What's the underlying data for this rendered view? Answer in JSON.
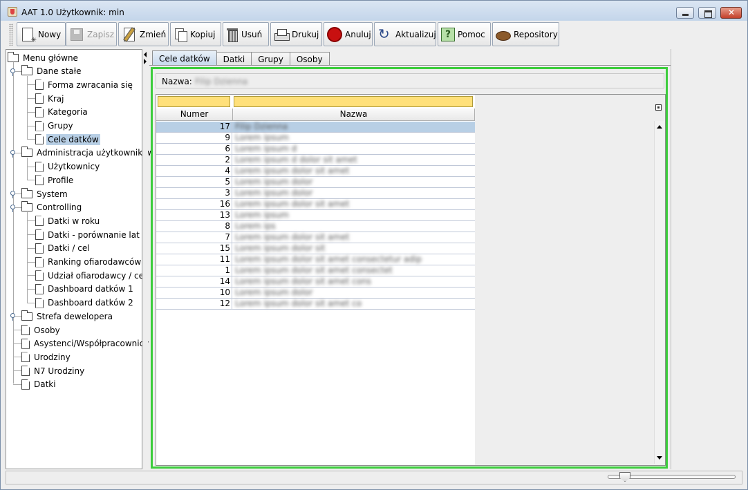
{
  "window": {
    "title": "AAT 1.0  Użytkownik: min"
  },
  "toolbar": {
    "buttons": [
      {
        "label": "Nowy",
        "icon": "new-document-icon",
        "enabled": true
      },
      {
        "label": "Zapisz",
        "icon": "save-disk-icon",
        "enabled": false
      },
      {
        "label": "Zmień",
        "icon": "edit-pencil-icon",
        "enabled": true
      },
      {
        "label": "Kopiuj",
        "icon": "copy-icon",
        "enabled": true
      },
      {
        "label": "Usuń",
        "icon": "trash-icon",
        "enabled": true
      },
      {
        "label": "Drukuj",
        "icon": "printer-icon",
        "enabled": true
      },
      {
        "label": "Anuluj",
        "icon": "stop-icon",
        "enabled": true
      },
      {
        "label": "Aktualizuj",
        "icon": "refresh-icon",
        "enabled": true
      },
      {
        "label": "Pomoc",
        "icon": "help-icon",
        "enabled": true
      },
      {
        "label": "Repository",
        "icon": "repository-icon",
        "enabled": true
      }
    ]
  },
  "tree": {
    "root": "Menu główne",
    "items": [
      {
        "label": "Dane stałe",
        "type": "folder",
        "level": 1,
        "expanded": true
      },
      {
        "label": "Forma zwracania się",
        "type": "leaf",
        "level": 2
      },
      {
        "label": "Kraj",
        "type": "leaf",
        "level": 2
      },
      {
        "label": "Kategoria",
        "type": "leaf",
        "level": 2
      },
      {
        "label": "Grupy",
        "type": "leaf",
        "level": 2
      },
      {
        "label": "Cele datków",
        "type": "leaf",
        "level": 2,
        "selected": true
      },
      {
        "label": "Administracja użytkowników",
        "type": "folder",
        "level": 1,
        "expanded": true
      },
      {
        "label": "Użytkownicy",
        "type": "leaf",
        "level": 2
      },
      {
        "label": "Profile",
        "type": "leaf",
        "level": 2
      },
      {
        "label": "System",
        "type": "folder",
        "level": 1,
        "expanded": false
      },
      {
        "label": "Controlling",
        "type": "folder",
        "level": 1,
        "expanded": true
      },
      {
        "label": "Datki w roku",
        "type": "leaf",
        "level": 2
      },
      {
        "label": "Datki - porównanie lat",
        "type": "leaf",
        "level": 2
      },
      {
        "label": "Datki / cel",
        "type": "leaf",
        "level": 2
      },
      {
        "label": "Ranking ofiarodawców",
        "type": "leaf",
        "level": 2
      },
      {
        "label": "Udział ofiarodawcy / cel",
        "type": "leaf",
        "level": 2
      },
      {
        "label": "Dashboard datków 1",
        "type": "leaf",
        "level": 2
      },
      {
        "label": "Dashboard datków 2",
        "type": "leaf",
        "level": 2
      },
      {
        "label": "Strefa dewelopera",
        "type": "folder",
        "level": 1,
        "expanded": false
      },
      {
        "label": "Osoby",
        "type": "leaf",
        "level": 1
      },
      {
        "label": "Asystenci/Współpracownicy",
        "type": "leaf",
        "level": 1
      },
      {
        "label": "Urodziny",
        "type": "leaf",
        "level": 1
      },
      {
        "label": "N7 Urodziny",
        "type": "leaf",
        "level": 1
      },
      {
        "label": "Datki",
        "type": "leaf",
        "level": 1
      }
    ]
  },
  "tabs": [
    {
      "label": "Cele datków",
      "active": true
    },
    {
      "label": "Datki",
      "active": false
    },
    {
      "label": "Grupy",
      "active": false
    },
    {
      "label": "Osoby",
      "active": false
    }
  ],
  "form": {
    "name_label": "Nazwa:",
    "name_value": "Filip Dzienna"
  },
  "table": {
    "columns": [
      "Numer",
      "Nazwa"
    ],
    "rows": [
      {
        "num": "17",
        "name": "Filip Dzienna",
        "selected": true
      },
      {
        "num": "9",
        "name": "Lorem ipsum",
        "selected": false
      },
      {
        "num": "6",
        "name": "Lorem ipsum d",
        "selected": false
      },
      {
        "num": "2",
        "name": "Lorem ipsum d dolor sit amet",
        "selected": false
      },
      {
        "num": "4",
        "name": "Lorem ipsum dolor sit amet",
        "selected": false
      },
      {
        "num": "5",
        "name": "Lorem ipsum dolor",
        "selected": false
      },
      {
        "num": "3",
        "name": "Lorem ipsum dolor",
        "selected": false
      },
      {
        "num": "16",
        "name": "Lorem ipsum dolor sit amet",
        "selected": false
      },
      {
        "num": "13",
        "name": "Lorem ipsum",
        "selected": false
      },
      {
        "num": "8",
        "name": "Lorem ips",
        "selected": false
      },
      {
        "num": "7",
        "name": "Lorem ipsum dolor sit amet",
        "selected": false
      },
      {
        "num": "15",
        "name": "Lorem ipsum dolor sit",
        "selected": false
      },
      {
        "num": "11",
        "name": "Lorem ipsum dolor sit amet consectetur adip",
        "selected": false
      },
      {
        "num": "1",
        "name": "Lorem ipsum dolor sit amet consectet",
        "selected": false
      },
      {
        "num": "14",
        "name": "Lorem ipsum dolor sit amet cons",
        "selected": false
      },
      {
        "num": "10",
        "name": "Lorem ipsum dolor",
        "selected": false
      },
      {
        "num": "12",
        "name": "Lorem ipsum dolor sit amet co",
        "selected": false
      }
    ]
  },
  "colors": {
    "selection": "#b8cfe5",
    "frame_border": "#3ccd3c",
    "filter_cell": "#ffe07a"
  }
}
